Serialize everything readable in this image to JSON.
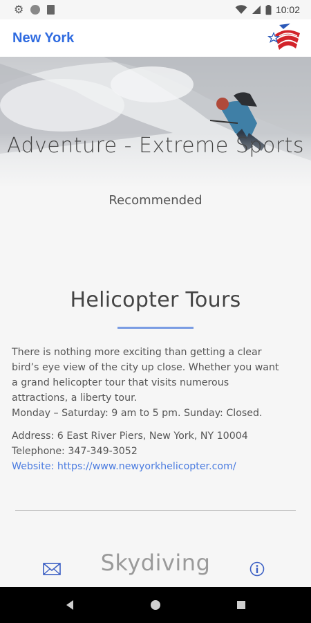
{
  "status_bar": {
    "time": "10:02",
    "icons": [
      "gear-icon",
      "circle-icon",
      "sim-card-icon",
      "wifi-icon",
      "signal-icon",
      "battery-icon"
    ]
  },
  "app_bar": {
    "title": "New York",
    "logo": "us-flag-star-logo"
  },
  "hero": {
    "category_title": "Adventure - Extreme Sports",
    "category_subtitle": "Recommended",
    "image": "skier-in-snow"
  },
  "item": {
    "title": "Helicopter Tours",
    "description_lines": [
      "There is nothing more exciting than getting a clear",
      "bird’s eye view of the city up close. Whether you want",
      "a grand helicopter tour that visits numerous",
      "attractions, a liberty tour.",
      "Monday – Saturday: 9 am to 5 pm. Sunday: Closed."
    ],
    "address": "Address: 6 East River Piers, New York, NY 10004",
    "telephone": "Telephone: 347-349-3052",
    "website": "Website: https://www.newyorkhelicopter.com/"
  },
  "next_item": {
    "title": "Skydiving"
  },
  "bottom_actions": {
    "left_icon": "mail-icon",
    "right_icon": "info-icon"
  },
  "colors": {
    "accent": "#2f6be0",
    "link": "#4a7be0",
    "underline": "#7a9ce3"
  }
}
